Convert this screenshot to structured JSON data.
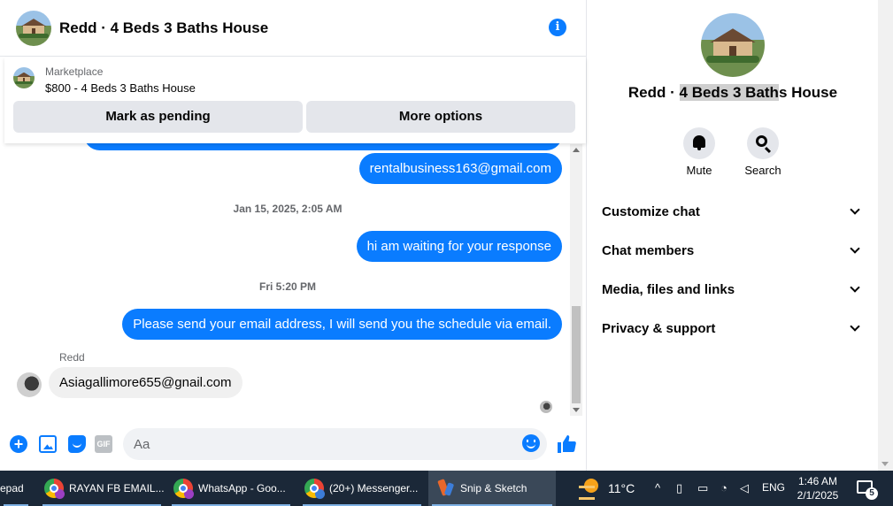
{
  "header": {
    "title": "Redd · 4 Beds 3 Baths House"
  },
  "marketplace": {
    "label": "Marketplace",
    "item": "$800 - 4 Beds 3 Baths House",
    "mark_pending_label": "Mark as pending",
    "more_options_label": "More options"
  },
  "messages": [
    {
      "type": "out",
      "text": "rentalbusiness163@gmail.com"
    },
    {
      "type": "timestamp",
      "text": "Jan 15, 2025, 2:05 AM"
    },
    {
      "type": "out",
      "text": "hi am waiting for your response"
    },
    {
      "type": "timestamp",
      "text": "Fri 5:20 PM"
    },
    {
      "type": "out",
      "text": "Please send your email address, I will send you the schedule via email."
    },
    {
      "type": "in",
      "sender": "Redd",
      "text": "Asiagallimore655@gnail.com"
    }
  ],
  "composer": {
    "placeholder": "Aa",
    "gif_label": "GIF"
  },
  "info": {
    "title_before": "Redd · ",
    "title_highlight": "4 Beds 3 Bath",
    "title_after": "s House",
    "mute_label": "Mute",
    "search_label": "Search",
    "sections": [
      {
        "label": "Customize chat"
      },
      {
        "label": "Chat members"
      },
      {
        "label": "Media, files and links"
      },
      {
        "label": "Privacy & support"
      }
    ]
  },
  "taskbar": {
    "tasks": [
      {
        "label": "epad"
      },
      {
        "label": "RAYAN FB EMAIL..."
      },
      {
        "label": "WhatsApp - Goo..."
      },
      {
        "label": "(20+) Messenger..."
      },
      {
        "label": "Snip & Sketch"
      }
    ],
    "temperature": "11°C",
    "language": "ENG",
    "time": "1:46 AM",
    "date": "2/1/2025",
    "notification_count": "5"
  },
  "colors": {
    "accent": "#0a7cff",
    "taskbar": "#1b2838"
  }
}
